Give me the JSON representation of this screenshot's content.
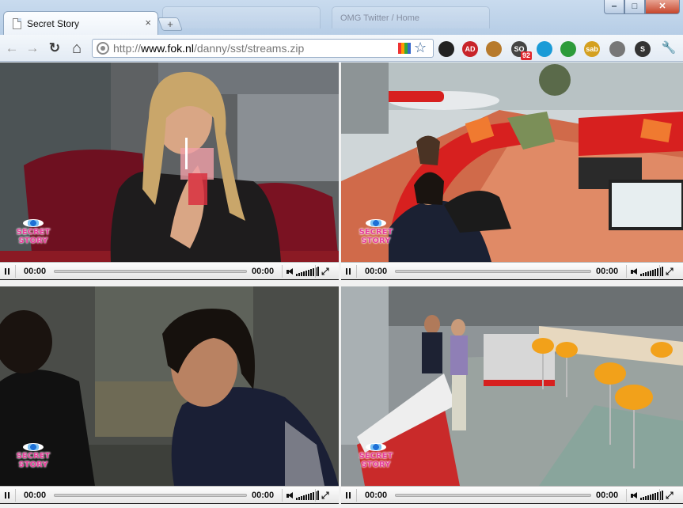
{
  "browser": {
    "tab_title": "Secret Story",
    "tab_close": "×",
    "new_tab": "+",
    "bg_tab_2_label": "ОМG Twitter / Home",
    "url_prefix": "http://",
    "url_host": "www.fok.nl",
    "url_path": "/danny/sst/streams.zip",
    "window": {
      "minimize": "‒",
      "maximize": "□",
      "close": "✕"
    },
    "nav": {
      "back": "←",
      "forward": "→",
      "reload": "↻",
      "home": "⌂"
    },
    "bookmark_star": "☆",
    "extensions": [
      {
        "name": "color-wheel-extension-icon",
        "color": "#222"
      },
      {
        "name": "adblock-extension-icon",
        "color": "#c8242a",
        "label": "AD"
      },
      {
        "name": "cookie-extension-icon",
        "color": "#b77a2c"
      },
      {
        "name": "seo-extension-icon",
        "color": "#444",
        "label": "SO",
        "badge": "92"
      },
      {
        "name": "ghost-extension-icon",
        "color": "#1a9bd7"
      },
      {
        "name": "green-gear-extension-icon",
        "color": "#2c9b3a"
      },
      {
        "name": "sab-extension-icon",
        "color": "#d4a020",
        "label": "sab"
      },
      {
        "name": "plugin-extension-icon",
        "color": "#777"
      },
      {
        "name": "s-extension-icon",
        "color": "#333",
        "label": "S"
      }
    ],
    "wrench": "🔧"
  },
  "streams": [
    {
      "id": "stream-1",
      "time_current": "00:00",
      "time_total": "00:00",
      "logo": [
        "SECRET",
        "STORY"
      ]
    },
    {
      "id": "stream-2",
      "time_current": "00:00",
      "time_total": "00:00",
      "logo": [
        "SECRET",
        "STORY"
      ]
    },
    {
      "id": "stream-3",
      "time_current": "00:00",
      "time_total": "00:00",
      "logo": [
        "SECRET",
        "STORY"
      ]
    },
    {
      "id": "stream-4",
      "time_current": "00:00",
      "time_total": "00:00",
      "logo": [
        "SECRET",
        "STORY"
      ]
    }
  ],
  "fullscreen_glyph": "⤢",
  "colors": {
    "player_bar": "#eeeeee",
    "logo_pink": "#e63f9b",
    "sofa_red": "#d7201f",
    "chair_orange": "#f2a11a"
  }
}
